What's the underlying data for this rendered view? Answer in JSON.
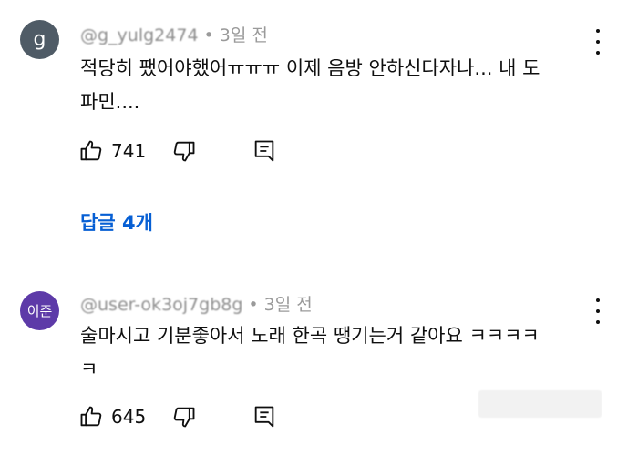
{
  "comments": [
    {
      "avatar_letter": "g",
      "avatar_color": "#4f5b66",
      "handle": "@g_yulg2474",
      "separator": "•",
      "time": "3일 전",
      "text": "적당히 팼어야했어ㅠㅠㅠ 이제 음방 안하신다자나... 내 도\n파민....",
      "likes": "741",
      "replies_label": "답글 4개",
      "more_icon": "vertical-ellipsis-icon"
    },
    {
      "avatar_letter": "이준",
      "avatar_color": "#5d3aa8",
      "handle": "@user-ok3oj7gb8g",
      "separator": "•",
      "time": "3일 전",
      "text": "술마시고 기분좋아서 노래 한곡 땡기는거 같아요 ㅋㅋㅋㅋ\nㅋ",
      "likes": "645",
      "more_icon": "vertical-ellipsis-icon"
    }
  ],
  "icons": {
    "like": "thumbs-up-icon",
    "dislike": "thumbs-down-icon",
    "reply": "comment-icon"
  },
  "colors": {
    "link": "#065fd4",
    "meta": "#9a9a9a",
    "text": "#0f0f0f"
  }
}
